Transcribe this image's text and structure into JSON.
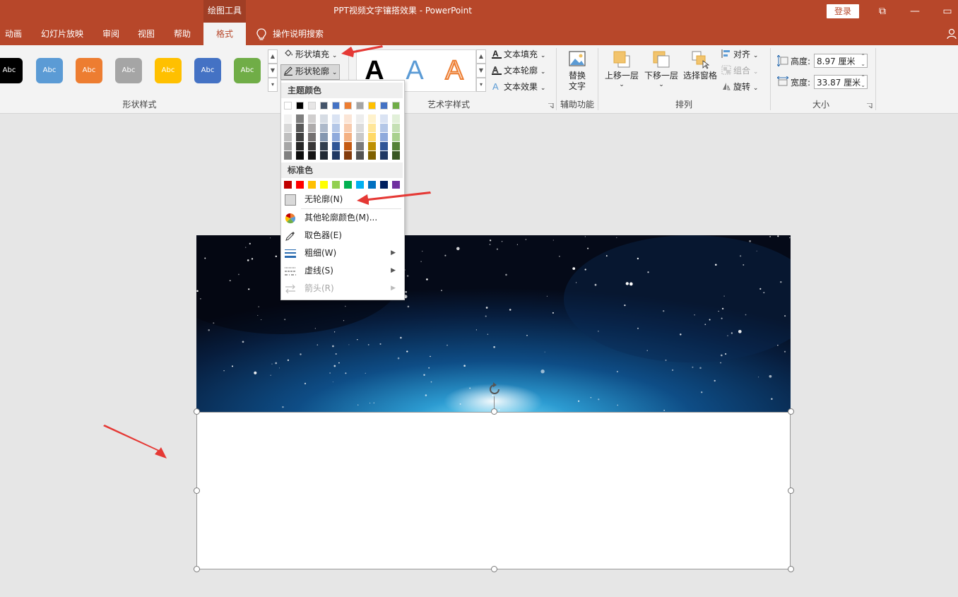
{
  "window": {
    "context_tab": "绘图工具",
    "title": "PPT视频文字镶搭效果  -  PowerPoint",
    "login": "登录",
    "restore_glyph": "⧉",
    "minimize_glyph": "—",
    "maximize_glyph": "▭"
  },
  "tabs": [
    {
      "label": "动画"
    },
    {
      "label": "幻灯片放映"
    },
    {
      "label": "审阅"
    },
    {
      "label": "视图"
    },
    {
      "label": "帮助"
    },
    {
      "label": "格式",
      "active": true
    }
  ],
  "tell_me": "操作说明搜索",
  "ribbon": {
    "shape_styles": {
      "label": "形状样式",
      "swatch_text": "Abc",
      "swatches": [
        "#000000",
        "#5b9bd5",
        "#ed7d31",
        "#a5a5a5",
        "#ffc000",
        "#4472c4",
        "#70ad47"
      ],
      "shape_fill": "形状填充",
      "shape_outline": "形状轮廓"
    },
    "wordart": {
      "label": "艺术字样式",
      "letter": "A",
      "text_fill": "文本填充",
      "text_outline": "文本轮廓",
      "text_effects": "文本效果"
    },
    "accessibility": {
      "label": "辅助功能",
      "alt_text_line1": "替换",
      "alt_text_line2": "文字"
    },
    "arrange": {
      "label": "排列",
      "bring_forward": "上移一层",
      "send_backward": "下移一层",
      "selection_pane": "选择窗格",
      "align": "对齐",
      "group": "组合",
      "rotate": "旋转"
    },
    "size": {
      "label": "大小",
      "height_label": "高度:",
      "height_value": "8.97 厘米",
      "width_label": "宽度:",
      "width_value": "33.87 厘米"
    }
  },
  "outline_menu": {
    "theme_colors_header": "主题颜色",
    "theme_top": [
      "#ffffff",
      "#000000",
      "#e7e6e6",
      "#44546a",
      "#4472c4",
      "#ed7d31",
      "#a5a5a5",
      "#ffc000",
      "#4472c4",
      "#70ad47"
    ],
    "theme_shades": [
      [
        "#f2f2f2",
        "#d9d9d9",
        "#bfbfbf",
        "#a6a6a6",
        "#808080"
      ],
      [
        "#7f7f7f",
        "#595959",
        "#404040",
        "#262626",
        "#0d0d0d"
      ],
      [
        "#d0cece",
        "#aeabab",
        "#757171",
        "#3a3838",
        "#171616"
      ],
      [
        "#d6dce4",
        "#adb9ca",
        "#8497b0",
        "#333f4f",
        "#222a35"
      ],
      [
        "#dae3f3",
        "#b4c7e7",
        "#8faadc",
        "#2f5597",
        "#203864"
      ],
      [
        "#fbe5d6",
        "#f8cbad",
        "#f4b183",
        "#c55a11",
        "#843c0c"
      ],
      [
        "#ededed",
        "#dbdbdb",
        "#c9c9c9",
        "#7b7b7b",
        "#525252"
      ],
      [
        "#fff2cc",
        "#ffe699",
        "#ffd966",
        "#bf9000",
        "#7f6000"
      ],
      [
        "#dae3f3",
        "#b4c7e7",
        "#8faadc",
        "#2f5597",
        "#203864"
      ],
      [
        "#e2f0d9",
        "#c5e0b4",
        "#a9d18e",
        "#548235",
        "#385723"
      ]
    ],
    "standard_colors_header": "标准色",
    "standard_colors": [
      "#c00000",
      "#ff0000",
      "#ffc000",
      "#ffff00",
      "#92d050",
      "#00b050",
      "#00b0f0",
      "#0070c0",
      "#002060",
      "#7030a0"
    ],
    "no_outline": "无轮廓(N)",
    "more_colors": "其他轮廓颜色(M)...",
    "eyedropper": "取色器(E)",
    "weight": "粗细(W)",
    "dashes": "虚线(S)",
    "arrows": "箭头(R)"
  }
}
